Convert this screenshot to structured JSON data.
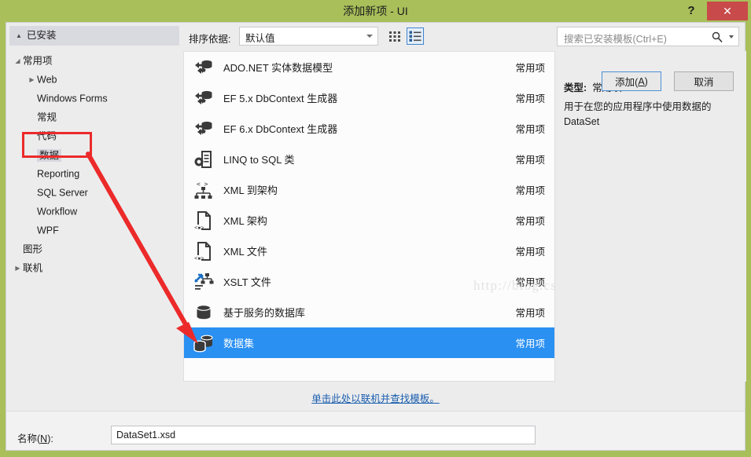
{
  "window": {
    "title": "添加新项 - UI",
    "help_label": "?",
    "close_label": "✕"
  },
  "sidebar": {
    "header": "已安装",
    "items": [
      {
        "label": "常用项",
        "level": 0,
        "twisty": "▲",
        "selected": false
      },
      {
        "label": "Web",
        "level": 1,
        "twisty": "▶",
        "selected": false
      },
      {
        "label": "Windows Forms",
        "level": 1,
        "twisty": "",
        "selected": false
      },
      {
        "label": "常规",
        "level": 1,
        "twisty": "",
        "selected": false
      },
      {
        "label": "代码",
        "level": 1,
        "twisty": "",
        "selected": false
      },
      {
        "label": "数据",
        "level": 1,
        "twisty": "",
        "selected": true
      },
      {
        "label": "Reporting",
        "level": 1,
        "twisty": "",
        "selected": false
      },
      {
        "label": "SQL Server",
        "level": 1,
        "twisty": "",
        "selected": false
      },
      {
        "label": "Workflow",
        "level": 1,
        "twisty": "",
        "selected": false
      },
      {
        "label": "WPF",
        "level": 1,
        "twisty": "",
        "selected": false
      },
      {
        "label": "图形",
        "level": 0,
        "twisty": "",
        "selected": false
      },
      {
        "label": "联机",
        "level": 0,
        "twisty": "▶",
        "selected": false
      }
    ]
  },
  "toolbar": {
    "sort_label": "排序依据:",
    "sort_value": "默认值",
    "grid_view_name": "grid-view",
    "list_view_name": "list-view",
    "search_placeholder": "搜索已安装模板(Ctrl+E)"
  },
  "templates": {
    "items": [
      {
        "name": "ADO.NET 实体数据模型",
        "category": "常用项",
        "icon": "ado-net-entity-icon",
        "selected": false
      },
      {
        "name": "EF 5.x DbContext 生成器",
        "category": "常用项",
        "icon": "ado-net-entity-icon",
        "selected": false
      },
      {
        "name": "EF 6.x DbContext 生成器",
        "category": "常用项",
        "icon": "ado-net-entity-icon",
        "selected": false
      },
      {
        "name": "LINQ to SQL 类",
        "category": "常用项",
        "icon": "linq-to-sql-icon",
        "selected": false
      },
      {
        "name": "XML 到架构",
        "category": "常用项",
        "icon": "xml-to-schema-icon",
        "selected": false
      },
      {
        "name": "XML 架构",
        "category": "常用项",
        "icon": "xml-file-icon",
        "selected": false
      },
      {
        "name": "XML 文件",
        "category": "常用项",
        "icon": "xml-file-icon",
        "selected": false
      },
      {
        "name": "XSLT 文件",
        "category": "常用项",
        "icon": "xslt-file-icon",
        "selected": false
      },
      {
        "name": "基于服务的数据库",
        "category": "常用项",
        "icon": "database-icon",
        "selected": false
      },
      {
        "name": "数据集",
        "category": "常用项",
        "icon": "dataset-icon",
        "selected": true
      }
    ],
    "watermark": "http://blog.csdn.net/"
  },
  "detail": {
    "type_label": "类型:",
    "type_value": "常用项",
    "description": "用于在您的应用程序中使用数据的 DataSet"
  },
  "footer": {
    "online_link": "单击此处以联机并查找模板。",
    "name_label_prefix": "名称(",
    "name_label_key": "N",
    "name_label_suffix": "):",
    "name_value": "DataSet1.xsd",
    "name_placeholder": "",
    "add_prefix": "添加(",
    "add_key": "A",
    "add_suffix": ")",
    "cancel_label": "取消"
  },
  "colors": {
    "title_bar": "#a8bf5a",
    "close_button": "#c84a4a",
    "selection": "#2a90f2",
    "annotation": "#ec2a2a",
    "link": "#1b5fae"
  }
}
